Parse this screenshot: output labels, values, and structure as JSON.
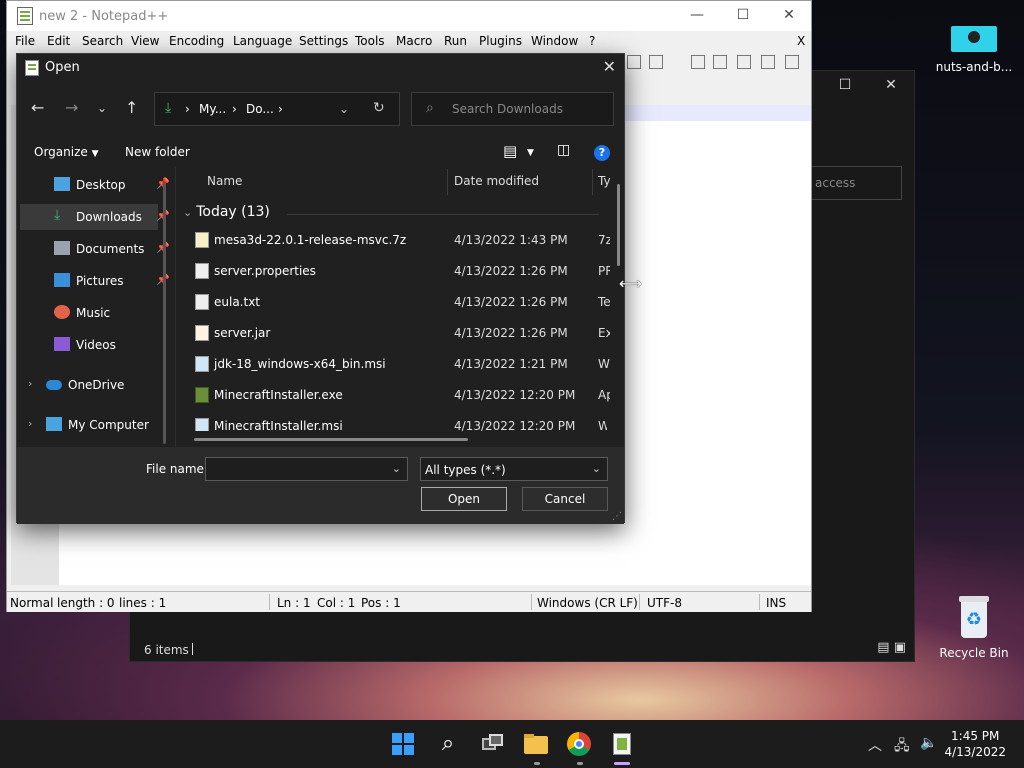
{
  "desktop": {
    "icons": [
      {
        "label": "nuts-and-b..."
      },
      {
        "label": "Recycle Bin"
      }
    ]
  },
  "background_window": {
    "search_placeholder": "access",
    "status": "6 items"
  },
  "notepad": {
    "title": "new 2 - Notepad++",
    "menu": [
      "File",
      "Edit",
      "Search",
      "View",
      "Encoding",
      "Language",
      "Settings",
      "Tools",
      "Macro",
      "Run",
      "Plugins",
      "Window",
      "?"
    ],
    "close_doc": "X",
    "statusbar": {
      "normal": "Normal",
      "length": "length : 0",
      "lines": "lines : 1",
      "ln": "Ln : 1",
      "col": "Col : 1",
      "pos": "Pos : 1",
      "eol": "Windows (CR LF)",
      "encoding": "UTF-8",
      "mode": "INS"
    }
  },
  "dialog": {
    "title": "Open",
    "breadcrumb": [
      "My...",
      "Do..."
    ],
    "search_placeholder": "Search Downloads",
    "organize": "Organize",
    "new_folder": "New folder",
    "help": "?",
    "sidebar": [
      {
        "label": "Desktop",
        "pinned": true,
        "selected": false
      },
      {
        "label": "Downloads",
        "pinned": true,
        "selected": true
      },
      {
        "label": "Documents",
        "pinned": true,
        "selected": false
      },
      {
        "label": "Pictures",
        "pinned": true,
        "selected": false
      },
      {
        "label": "Music",
        "pinned": false,
        "selected": false
      },
      {
        "label": "Videos",
        "pinned": false,
        "selected": false
      },
      {
        "label": "OneDrive",
        "pinned": false,
        "selected": false
      },
      {
        "label": "My Computer",
        "pinned": false,
        "selected": false
      }
    ],
    "columns": {
      "name": "Name",
      "date": "Date modified",
      "type": "Ty"
    },
    "group": "Today (13)",
    "files": [
      {
        "name": "mesa3d-22.0.1-release-msvc.7z",
        "date": "4/13/2022 1:43 PM",
        "type": "7z"
      },
      {
        "name": "server.properties",
        "date": "4/13/2022 1:26 PM",
        "type": "PR"
      },
      {
        "name": "eula.txt",
        "date": "4/13/2022 1:26 PM",
        "type": "Te"
      },
      {
        "name": "server.jar",
        "date": "4/13/2022 1:26 PM",
        "type": "Ex"
      },
      {
        "name": "jdk-18_windows-x64_bin.msi",
        "date": "4/13/2022 1:21 PM",
        "type": "W"
      },
      {
        "name": "MinecraftInstaller.exe",
        "date": "4/13/2022 12:20 PM",
        "type": "Ap"
      },
      {
        "name": "MinecraftInstaller.msi",
        "date": "4/13/2022 12:20 PM",
        "type": "W"
      }
    ],
    "file_name_label": "File name:",
    "file_name_value": "",
    "file_type": "All types (*.*)",
    "open_button": "Open",
    "cancel_button": "Cancel"
  },
  "taskbar": {
    "time": "1:45 PM",
    "date": "4/13/2022"
  },
  "colors": {
    "dialog_bg": "#202020",
    "taskbar_bg": "#1c1c1c",
    "help_blue": "#1a73e8"
  }
}
